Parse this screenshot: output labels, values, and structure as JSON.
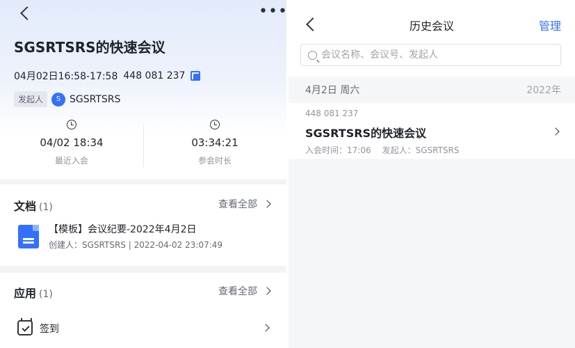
{
  "left": {
    "more_label": "•••",
    "title": "SGSRTSRS的快速会议",
    "time_range": "04月02日16:58-17:58",
    "meeting_id": "448 081 237",
    "host": {
      "tag": "发起人",
      "avatar_initial": "S",
      "name": "SGSRTSRS"
    },
    "stats": [
      {
        "value": "04/02 18:34",
        "label": "最近入会",
        "icon": "history-icon"
      },
      {
        "value": "03:34:21",
        "label": "参会时长",
        "icon": "clock-icon"
      }
    ],
    "documents": {
      "title": "文档",
      "count": "(1)",
      "view_all": "查看全部",
      "items": [
        {
          "title": "【模板】会议纪要-2022年4月2日",
          "meta": "创建人：SGSRTSRS | 2022-04-02 23:07:49",
          "icon": "doc-icon"
        }
      ]
    },
    "apps": {
      "title": "应用",
      "count": "(1)",
      "view_all": "查看全部",
      "items": [
        {
          "label": "签到",
          "icon": "checkin-icon"
        }
      ]
    }
  },
  "right": {
    "title": "历史会议",
    "manage_label": "管理",
    "search": {
      "placeholder": "会议名称、会议号、发起人",
      "value": ""
    },
    "groups": [
      {
        "date": "4月2日 周六",
        "year": "2022年",
        "items": [
          {
            "meeting_id": "448 081 237",
            "title": "SGSRTSRS的快速会议",
            "join_time": "入会时间：17:06",
            "host": "发起人：SGSRTSRS"
          }
        ]
      }
    ]
  },
  "colors": {
    "accent": "#3370ff",
    "text": "#1f2329",
    "muted": "#8f959e",
    "background": "#f2f3f5"
  }
}
